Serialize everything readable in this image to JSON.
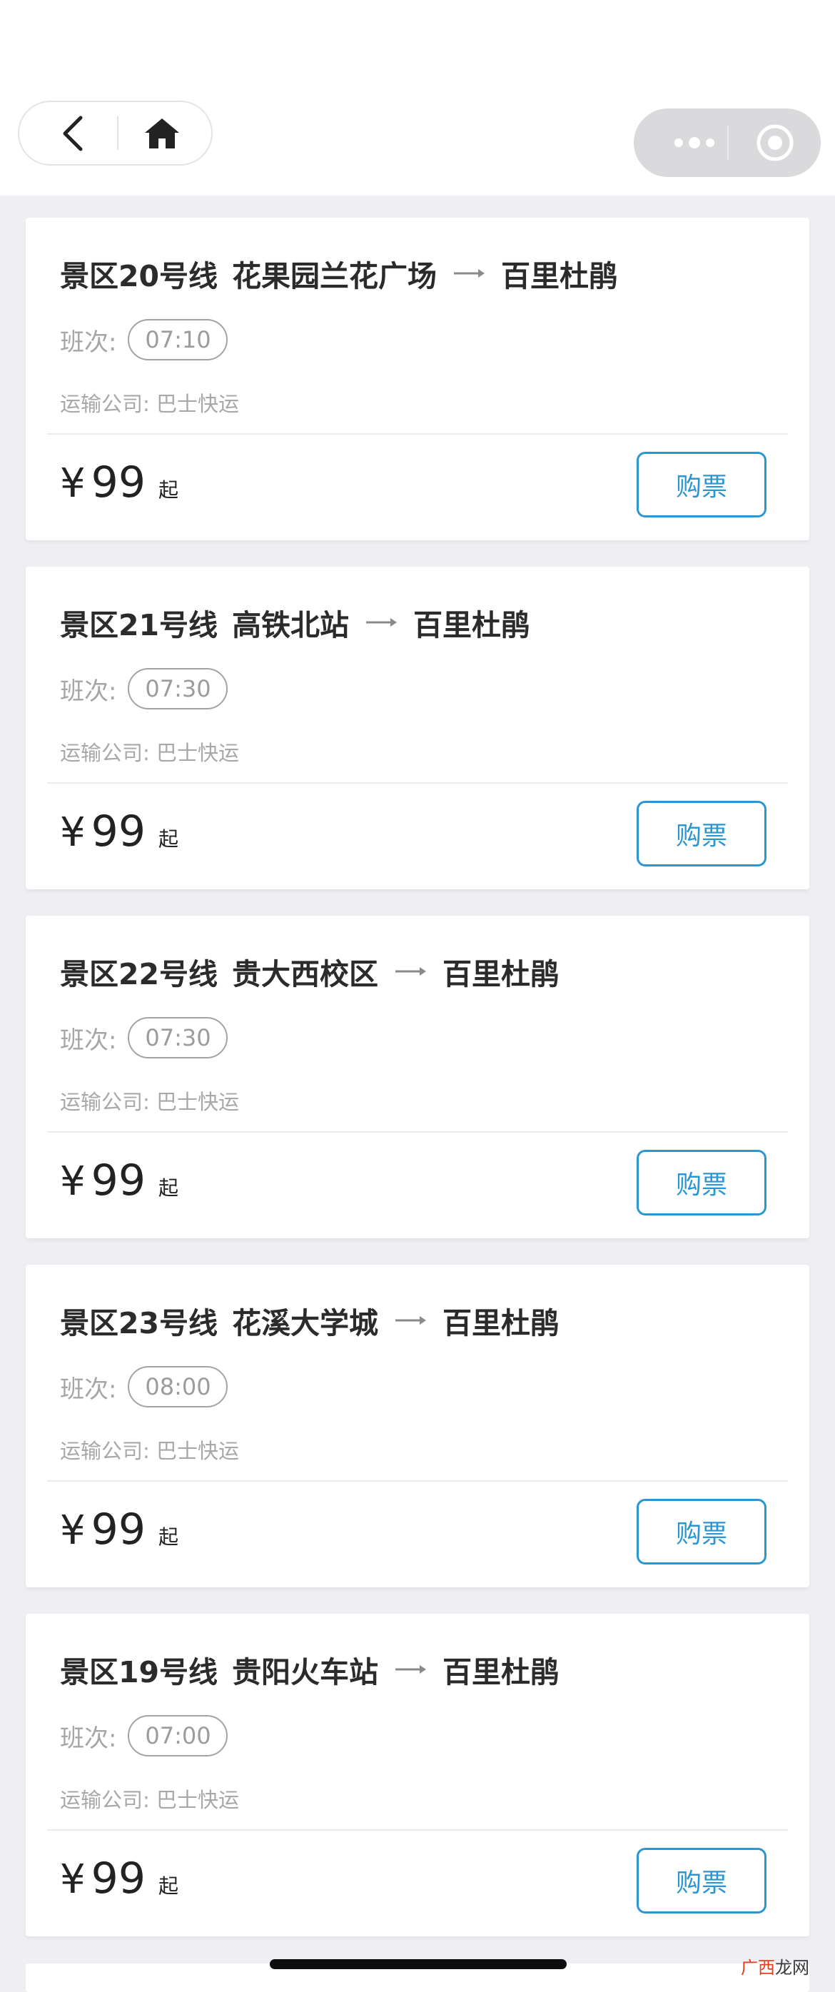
{
  "nav": {
    "back_icon": "chevron-left-icon",
    "home_icon": "home-icon",
    "more_icon": "more-dots-icon",
    "close_icon": "target-circle-icon"
  },
  "routes": [
    {
      "line": "景区20号线",
      "from": "花果园兰花广场",
      "to": "百里杜鹃",
      "schedule_label": "班次:",
      "time": "07:10",
      "company": "运输公司: 巴士快运",
      "currency": "¥",
      "price": "99",
      "price_suffix": "起",
      "buy_label": "购票"
    },
    {
      "line": "景区21号线",
      "from": "高铁北站",
      "to": "百里杜鹃",
      "schedule_label": "班次:",
      "time": "07:30",
      "company": "运输公司: 巴士快运",
      "currency": "¥",
      "price": "99",
      "price_suffix": "起",
      "buy_label": "购票"
    },
    {
      "line": "景区22号线",
      "from": "贵大西校区",
      "to": "百里杜鹃",
      "schedule_label": "班次:",
      "time": "07:30",
      "company": "运输公司: 巴士快运",
      "currency": "¥",
      "price": "99",
      "price_suffix": "起",
      "buy_label": "购票"
    },
    {
      "line": "景区23号线",
      "from": "花溪大学城",
      "to": "百里杜鹃",
      "schedule_label": "班次:",
      "time": "08:00",
      "company": "运输公司: 巴士快运",
      "currency": "¥",
      "price": "99",
      "price_suffix": "起",
      "buy_label": "购票"
    },
    {
      "line": "景区19号线",
      "from": "贵阳火车站",
      "to": "百里杜鹃",
      "schedule_label": "班次:",
      "time": "07:00",
      "company": "运输公司: 巴士快运",
      "currency": "¥",
      "price": "99",
      "price_suffix": "起",
      "buy_label": "购票"
    }
  ],
  "watermark": {
    "part1": "广西",
    "part2": "龙网"
  },
  "colors": {
    "accent": "#2a96d2",
    "page_bg": "#eeeef3"
  }
}
